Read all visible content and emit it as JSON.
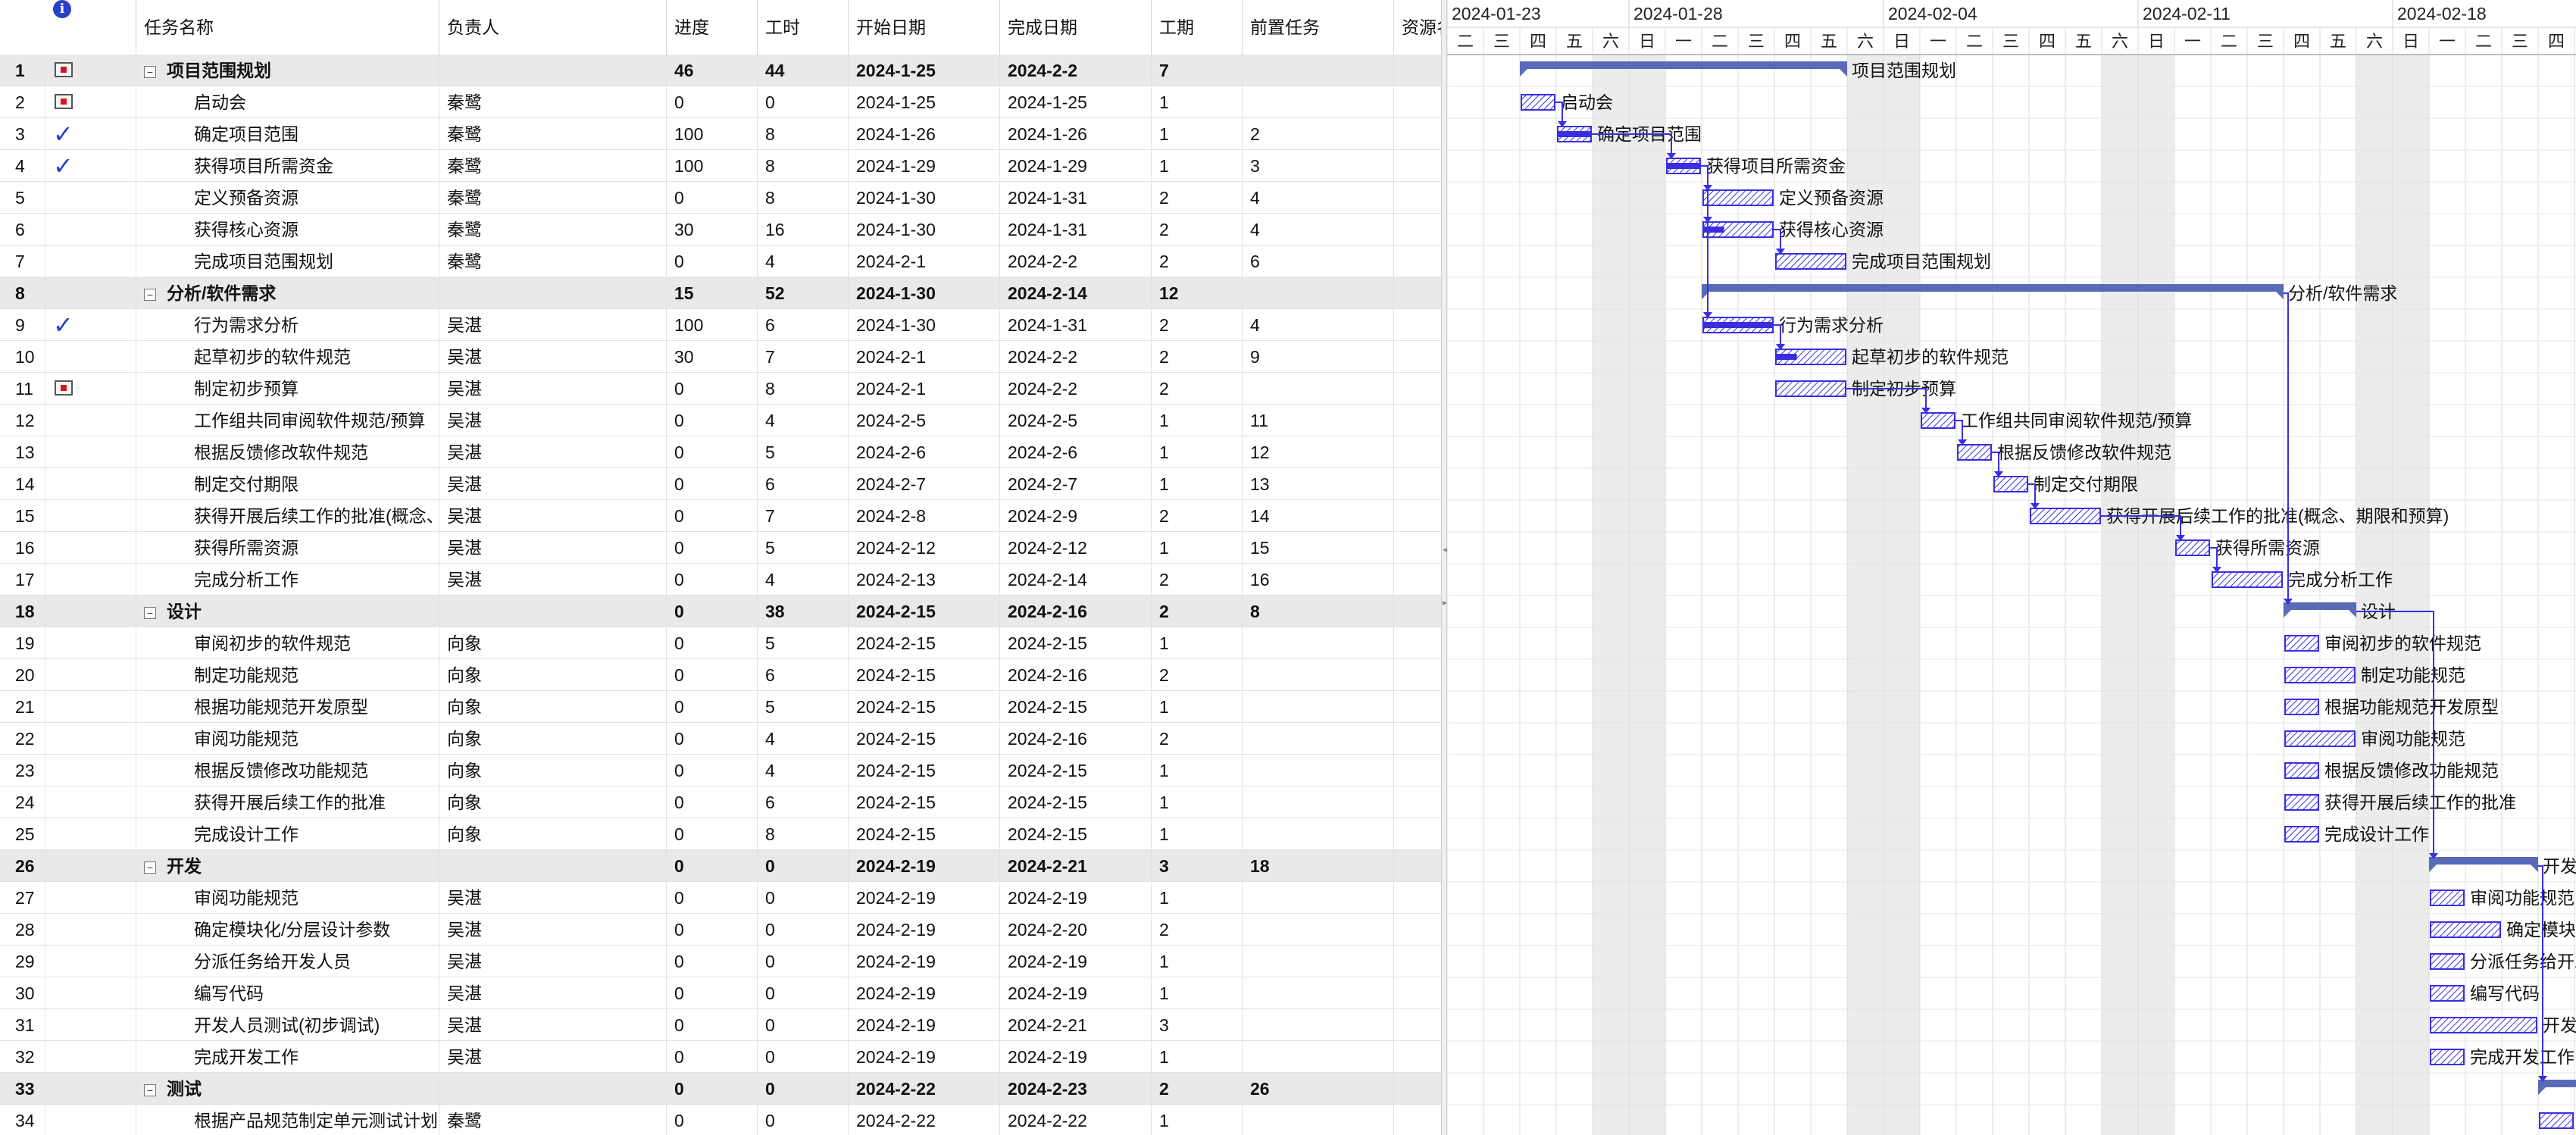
{
  "columns": {
    "info": "i",
    "name": "任务名称",
    "owner": "负责人",
    "progress": "进度",
    "work": "工时",
    "start": "开始日期",
    "finish": "完成日期",
    "duration": "工期",
    "predecessors": "前置任务",
    "resources": "资源名称"
  },
  "tasks": [
    {
      "no": "1",
      "icon": "note",
      "name": "项目范围规划",
      "owner": "",
      "progress": "46",
      "work": "44",
      "start": "2024-1-25",
      "finish": "2024-2-2",
      "duration": "7",
      "pred": "",
      "summary": true,
      "s": 2,
      "d": 9,
      "p": 46
    },
    {
      "no": "2",
      "icon": "note",
      "name": "启动会",
      "owner": "秦鹭",
      "progress": "0",
      "work": "0",
      "start": "2024-1-25",
      "finish": "2024-1-25",
      "duration": "1",
      "pred": "",
      "summary": false,
      "s": 2,
      "d": 1,
      "p": 0
    },
    {
      "no": "3",
      "icon": "check",
      "name": "确定项目范围",
      "owner": "秦鹭",
      "progress": "100",
      "work": "8",
      "start": "2024-1-26",
      "finish": "2024-1-26",
      "duration": "1",
      "pred": "2",
      "summary": false,
      "s": 3,
      "d": 1,
      "p": 100
    },
    {
      "no": "4",
      "icon": "check",
      "name": "获得项目所需资金",
      "owner": "秦鹭",
      "progress": "100",
      "work": "8",
      "start": "2024-1-29",
      "finish": "2024-1-29",
      "duration": "1",
      "pred": "3",
      "summary": false,
      "s": 6,
      "d": 1,
      "p": 100
    },
    {
      "no": "5",
      "icon": "",
      "name": "定义预备资源",
      "owner": "秦鹭",
      "progress": "0",
      "work": "8",
      "start": "2024-1-30",
      "finish": "2024-1-31",
      "duration": "2",
      "pred": "4",
      "summary": false,
      "s": 7,
      "d": 2,
      "p": 0
    },
    {
      "no": "6",
      "icon": "",
      "name": "获得核心资源",
      "owner": "秦鹭",
      "progress": "30",
      "work": "16",
      "start": "2024-1-30",
      "finish": "2024-1-31",
      "duration": "2",
      "pred": "4",
      "summary": false,
      "s": 7,
      "d": 2,
      "p": 30
    },
    {
      "no": "7",
      "icon": "",
      "name": "完成项目范围规划",
      "owner": "秦鹭",
      "progress": "0",
      "work": "4",
      "start": "2024-2-1",
      "finish": "2024-2-2",
      "duration": "2",
      "pred": "6",
      "summary": false,
      "s": 9,
      "d": 2,
      "p": 0
    },
    {
      "no": "8",
      "icon": "",
      "name": "分析/软件需求",
      "owner": "",
      "progress": "15",
      "work": "52",
      "start": "2024-1-30",
      "finish": "2024-2-14",
      "duration": "12",
      "pred": "",
      "summary": true,
      "s": 7,
      "d": 16,
      "p": 15
    },
    {
      "no": "9",
      "icon": "check",
      "name": "行为需求分析",
      "owner": "吴湛",
      "progress": "100",
      "work": "6",
      "start": "2024-1-30",
      "finish": "2024-1-31",
      "duration": "2",
      "pred": "4",
      "summary": false,
      "s": 7,
      "d": 2,
      "p": 100
    },
    {
      "no": "10",
      "icon": "",
      "name": "起草初步的软件规范",
      "owner": "吴湛",
      "progress": "30",
      "work": "7",
      "start": "2024-2-1",
      "finish": "2024-2-2",
      "duration": "2",
      "pred": "9",
      "summary": false,
      "s": 9,
      "d": 2,
      "p": 30
    },
    {
      "no": "11",
      "icon": "note",
      "name": "制定初步预算",
      "owner": "吴湛",
      "progress": "0",
      "work": "8",
      "start": "2024-2-1",
      "finish": "2024-2-2",
      "duration": "2",
      "pred": "",
      "summary": false,
      "s": 9,
      "d": 2,
      "p": 0
    },
    {
      "no": "12",
      "icon": "",
      "name": "工作组共同审阅软件规范/预算",
      "owner": "吴湛",
      "progress": "0",
      "work": "4",
      "start": "2024-2-5",
      "finish": "2024-2-5",
      "duration": "1",
      "pred": "11",
      "summary": false,
      "s": 13,
      "d": 1,
      "p": 0
    },
    {
      "no": "13",
      "icon": "",
      "name": "根据反馈修改软件规范",
      "owner": "吴湛",
      "progress": "0",
      "work": "5",
      "start": "2024-2-6",
      "finish": "2024-2-6",
      "duration": "1",
      "pred": "12",
      "summary": false,
      "s": 14,
      "d": 1,
      "p": 0
    },
    {
      "no": "14",
      "icon": "",
      "name": "制定交付期限",
      "owner": "吴湛",
      "progress": "0",
      "work": "6",
      "start": "2024-2-7",
      "finish": "2024-2-7",
      "duration": "1",
      "pred": "13",
      "summary": false,
      "s": 15,
      "d": 1,
      "p": 0
    },
    {
      "no": "15",
      "icon": "",
      "name": "获得开展后续工作的批准(概念、期限和预算)",
      "owner": "吴湛",
      "progress": "0",
      "work": "7",
      "start": "2024-2-8",
      "finish": "2024-2-9",
      "duration": "2",
      "pred": "14",
      "summary": false,
      "s": 16,
      "d": 2,
      "p": 0
    },
    {
      "no": "16",
      "icon": "",
      "name": "获得所需资源",
      "owner": "吴湛",
      "progress": "0",
      "work": "5",
      "start": "2024-2-12",
      "finish": "2024-2-12",
      "duration": "1",
      "pred": "15",
      "summary": false,
      "s": 20,
      "d": 1,
      "p": 0
    },
    {
      "no": "17",
      "icon": "",
      "name": "完成分析工作",
      "owner": "吴湛",
      "progress": "0",
      "work": "4",
      "start": "2024-2-13",
      "finish": "2024-2-14",
      "duration": "2",
      "pred": "16",
      "summary": false,
      "s": 21,
      "d": 2,
      "p": 0
    },
    {
      "no": "18",
      "icon": "",
      "name": "设计",
      "owner": "",
      "progress": "0",
      "work": "38",
      "start": "2024-2-15",
      "finish": "2024-2-16",
      "duration": "2",
      "pred": "8",
      "summary": true,
      "s": 23,
      "d": 2,
      "p": 0
    },
    {
      "no": "19",
      "icon": "",
      "name": "审阅初步的软件规范",
      "owner": "向象",
      "progress": "0",
      "work": "5",
      "start": "2024-2-15",
      "finish": "2024-2-15",
      "duration": "1",
      "pred": "",
      "summary": false,
      "s": 23,
      "d": 1,
      "p": 0
    },
    {
      "no": "20",
      "icon": "",
      "name": "制定功能规范",
      "owner": "向象",
      "progress": "0",
      "work": "6",
      "start": "2024-2-15",
      "finish": "2024-2-16",
      "duration": "2",
      "pred": "",
      "summary": false,
      "s": 23,
      "d": 2,
      "p": 0
    },
    {
      "no": "21",
      "icon": "",
      "name": "根据功能规范开发原型",
      "owner": "向象",
      "progress": "0",
      "work": "5",
      "start": "2024-2-15",
      "finish": "2024-2-15",
      "duration": "1",
      "pred": "",
      "summary": false,
      "s": 23,
      "d": 1,
      "p": 0
    },
    {
      "no": "22",
      "icon": "",
      "name": "审阅功能规范",
      "owner": "向象",
      "progress": "0",
      "work": "4",
      "start": "2024-2-15",
      "finish": "2024-2-16",
      "duration": "2",
      "pred": "",
      "summary": false,
      "s": 23,
      "d": 2,
      "p": 0
    },
    {
      "no": "23",
      "icon": "",
      "name": "根据反馈修改功能规范",
      "owner": "向象",
      "progress": "0",
      "work": "4",
      "start": "2024-2-15",
      "finish": "2024-2-15",
      "duration": "1",
      "pred": "",
      "summary": false,
      "s": 23,
      "d": 1,
      "p": 0
    },
    {
      "no": "24",
      "icon": "",
      "name": "获得开展后续工作的批准",
      "owner": "向象",
      "progress": "0",
      "work": "6",
      "start": "2024-2-15",
      "finish": "2024-2-15",
      "duration": "1",
      "pred": "",
      "summary": false,
      "s": 23,
      "d": 1,
      "p": 0
    },
    {
      "no": "25",
      "icon": "",
      "name": "完成设计工作",
      "owner": "向象",
      "progress": "0",
      "work": "8",
      "start": "2024-2-15",
      "finish": "2024-2-15",
      "duration": "1",
      "pred": "",
      "summary": false,
      "s": 23,
      "d": 1,
      "p": 0
    },
    {
      "no": "26",
      "icon": "",
      "name": "开发",
      "owner": "",
      "progress": "0",
      "work": "0",
      "start": "2024-2-19",
      "finish": "2024-2-21",
      "duration": "3",
      "pred": "18",
      "summary": true,
      "s": 27,
      "d": 3,
      "p": 0
    },
    {
      "no": "27",
      "icon": "",
      "name": "审阅功能规范",
      "owner": "吴湛",
      "progress": "0",
      "work": "0",
      "start": "2024-2-19",
      "finish": "2024-2-19",
      "duration": "1",
      "pred": "",
      "summary": false,
      "s": 27,
      "d": 1,
      "p": 0
    },
    {
      "no": "28",
      "icon": "",
      "name": "确定模块化/分层设计参数",
      "owner": "吴湛",
      "progress": "0",
      "work": "0",
      "start": "2024-2-19",
      "finish": "2024-2-20",
      "duration": "2",
      "pred": "",
      "summary": false,
      "s": 27,
      "d": 2,
      "p": 0
    },
    {
      "no": "29",
      "icon": "",
      "name": "分派任务给开发人员",
      "owner": "吴湛",
      "progress": "0",
      "work": "0",
      "start": "2024-2-19",
      "finish": "2024-2-19",
      "duration": "1",
      "pred": "",
      "summary": false,
      "s": 27,
      "d": 1,
      "p": 0
    },
    {
      "no": "30",
      "icon": "",
      "name": "编写代码",
      "owner": "吴湛",
      "progress": "0",
      "work": "0",
      "start": "2024-2-19",
      "finish": "2024-2-19",
      "duration": "1",
      "pred": "",
      "summary": false,
      "s": 27,
      "d": 1,
      "p": 0
    },
    {
      "no": "31",
      "icon": "",
      "name": "开发人员测试(初步调试)",
      "owner": "吴湛",
      "progress": "0",
      "work": "0",
      "start": "2024-2-19",
      "finish": "2024-2-21",
      "duration": "3",
      "pred": "",
      "summary": false,
      "s": 27,
      "d": 3,
      "p": 0
    },
    {
      "no": "32",
      "icon": "",
      "name": "完成开发工作",
      "owner": "吴湛",
      "progress": "0",
      "work": "0",
      "start": "2024-2-19",
      "finish": "2024-2-19",
      "duration": "1",
      "pred": "",
      "summary": false,
      "s": 27,
      "d": 1,
      "p": 0
    },
    {
      "no": "33",
      "icon": "",
      "name": "测试",
      "owner": "",
      "progress": "0",
      "work": "0",
      "start": "2024-2-22",
      "finish": "2024-2-23",
      "duration": "2",
      "pred": "26",
      "summary": true,
      "s": 30,
      "d": 2,
      "p": 0
    },
    {
      "no": "34",
      "icon": "",
      "name": "根据产品规范制定单元测试计划",
      "owner": "秦鹭",
      "progress": "0",
      "work": "0",
      "start": "2024-2-22",
      "finish": "2024-2-22",
      "duration": "1",
      "pred": "",
      "summary": false,
      "s": 30,
      "d": 1,
      "p": 0
    }
  ],
  "gantt": {
    "weeks": [
      "2024-01-23",
      "2024-01-28",
      "2024-02-04",
      "2024-02-11",
      "2024-02-18"
    ],
    "weekdays": [
      "一",
      "二",
      "三",
      "四",
      "五",
      "六",
      "日"
    ],
    "colors": {
      "bar": "#3a2ee0",
      "summary": "#5a6ab8",
      "weekend": "#ececec",
      "grid": "#e4e4e4"
    }
  }
}
